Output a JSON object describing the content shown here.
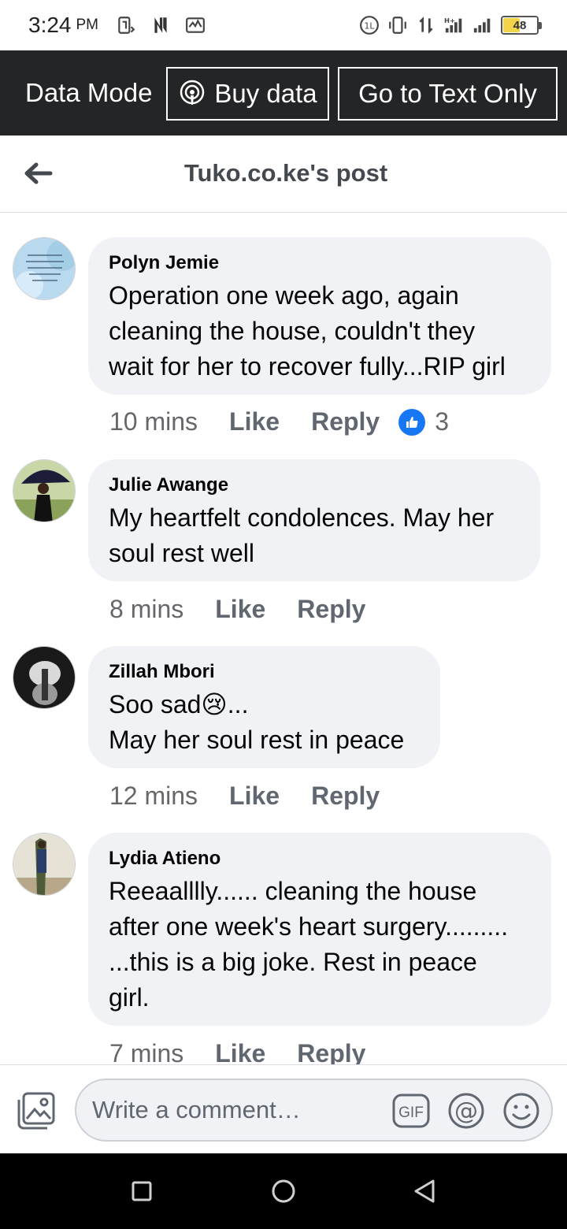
{
  "status_bar": {
    "time": "3:24",
    "ampm": "PM",
    "battery": "48",
    "battery_level": 0.48
  },
  "data_mode": {
    "label": "Data Mode",
    "buy_label": "Buy data",
    "text_only_label": "Go to Text Only"
  },
  "header": {
    "title": "Tuko.co.ke's post"
  },
  "comments": [
    {
      "name": "Polyn Jemie",
      "lines": [
        "Operation one week ago, again",
        "cleaning the house, couldn't they",
        "wait for her to recover fully...RIP girl"
      ],
      "time": "10 mins",
      "like": "Like",
      "reply": "Reply",
      "reactions": "3"
    },
    {
      "name": "Julie Awange",
      "lines": [
        "My heartfelt condolences. May her",
        "soul rest well"
      ],
      "time": "8 mins",
      "like": "Like",
      "reply": "Reply"
    },
    {
      "name": "Zillah Mbori",
      "lines": [
        "Soo sad😢...",
        "May her soul rest in peace"
      ],
      "time": "12 mins",
      "like": "Like",
      "reply": "Reply"
    },
    {
      "name": "Lydia Atieno",
      "lines": [
        "Reeaalllly...... cleaning the house",
        "after one week's heart surgery.........",
        "...this is a big joke. Rest in peace",
        "girl."
      ],
      "time": "7 mins",
      "like": "Like",
      "reply": "Reply"
    }
  ],
  "composer": {
    "placeholder": "Write a comment…",
    "gif_label": "GIF"
  },
  "colors": {
    "data_bar_bg": "#242526",
    "bubble_bg": "#f0f2f5",
    "like_blue": "#1877f2",
    "muted_text": "#65676b"
  }
}
